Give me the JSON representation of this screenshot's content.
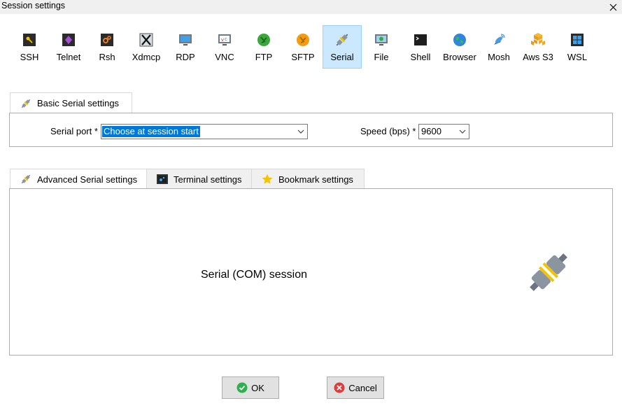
{
  "window": {
    "title": "Session settings"
  },
  "toolbar": {
    "items": [
      {
        "label": "SSH",
        "icon": "ssh-key-icon"
      },
      {
        "label": "Telnet",
        "icon": "telnet-icon"
      },
      {
        "label": "Rsh",
        "icon": "rsh-icon"
      },
      {
        "label": "Xdmcp",
        "icon": "xdmcp-icon"
      },
      {
        "label": "RDP",
        "icon": "rdp-icon"
      },
      {
        "label": "VNC",
        "icon": "vnc-icon"
      },
      {
        "label": "FTP",
        "icon": "ftp-icon"
      },
      {
        "label": "SFTP",
        "icon": "sftp-icon"
      },
      {
        "label": "Serial",
        "icon": "serial-plug-icon",
        "selected": true
      },
      {
        "label": "File",
        "icon": "file-icon"
      },
      {
        "label": "Shell",
        "icon": "shell-icon"
      },
      {
        "label": "Browser",
        "icon": "browser-globe-icon"
      },
      {
        "label": "Mosh",
        "icon": "mosh-satellite-icon"
      },
      {
        "label": "Aws S3",
        "icon": "aws-s3-icon"
      },
      {
        "label": "WSL",
        "icon": "wsl-windows-icon"
      }
    ]
  },
  "basic": {
    "tab_label": "Basic Serial settings",
    "serial_port_label": "Serial port *",
    "serial_port_value": "Choose at session start",
    "speed_label": "Speed (bps) *",
    "speed_value": "9600"
  },
  "advanced_tabs": [
    {
      "label": "Advanced Serial settings",
      "icon": "serial-plug-icon",
      "active": true
    },
    {
      "label": "Terminal settings",
      "icon": "terminal-icon"
    },
    {
      "label": "Bookmark settings",
      "icon": "star-icon"
    }
  ],
  "main": {
    "description": "Serial (COM) session"
  },
  "buttons": {
    "ok": "OK",
    "cancel": "Cancel"
  },
  "colors": {
    "selection": "#cce8ff",
    "highlight": "#0078d7",
    "ok_green": "#2bb24c",
    "cancel_red": "#e03c3c"
  }
}
